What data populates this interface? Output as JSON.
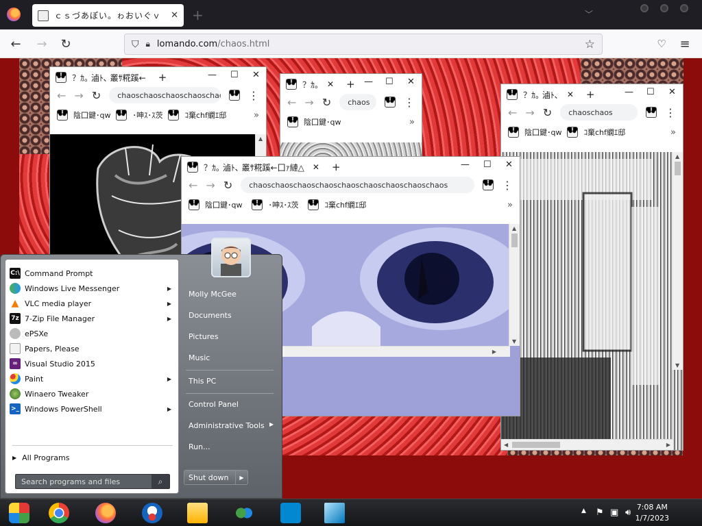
{
  "firefox": {
    "tab_title": "ｃｓづあぽい。ゎおいぐｖ",
    "url_host": "lomando.com",
    "url_path": "/chaos.html"
  },
  "windows": {
    "w1": {
      "tab": "？ｶ｡ 滷ﾄ､ 叢ｻ糀蹊←",
      "omnibox": "chaoschaoschaoschaoschao",
      "bookmarks": [
        "陰囗鍵･qw",
        "･呻ｽ･ｽ茨",
        "ｺ棄chf繝ｴ邸"
      ]
    },
    "w2": {
      "tab": "？ｶ｡",
      "omnibox": "chaos",
      "bookmarks": [
        "陰囗鍵･qw"
      ]
    },
    "w3": {
      "tab": "？ｶ｡ 滷ﾄ､",
      "omnibox": "chaoschaos",
      "bookmarks": [
        "陰囗鍵･qw",
        "ｺ棄chf繝ｴ邸"
      ]
    },
    "w4": {
      "tab": "？ｶ｡ 滷ﾄ､ 叢ｻ糀蹊←囗ｧ縺△",
      "omnibox": "chaoschaoschaoschaoschaoschaoschaoschaoschaos",
      "bookmarks": [
        "陰囗鍵･qw",
        "･呻ｽ･ｽ茨",
        "ｺ棄chf繝ｴ邸"
      ]
    }
  },
  "start_menu": {
    "programs": [
      {
        "label": "Command Prompt",
        "icon": "cmd-icon",
        "submenu": false
      },
      {
        "label": "Windows Live Messenger",
        "icon": "messenger-icon",
        "submenu": true
      },
      {
        "label": "VLC media player",
        "icon": "vlc-icon",
        "submenu": true
      },
      {
        "label": "7-Zip File Manager",
        "icon": "7zip-icon",
        "submenu": true
      },
      {
        "label": "ePSXe",
        "icon": "epsxe-icon",
        "submenu": false
      },
      {
        "label": "Papers, Please",
        "icon": "document-icon",
        "submenu": false
      },
      {
        "label": "Visual Studio 2015",
        "icon": "visual-studio-icon",
        "submenu": false
      },
      {
        "label": "Paint",
        "icon": "paint-icon",
        "submenu": true
      },
      {
        "label": "Winaero Tweaker",
        "icon": "winaero-icon",
        "submenu": false
      },
      {
        "label": "Windows PowerShell",
        "icon": "powershell-icon",
        "submenu": true
      }
    ],
    "all_programs": "All Programs",
    "search_placeholder": "Search programs and files",
    "right_items": [
      "Molly McGee",
      "Documents",
      "Pictures",
      "Music",
      "This PC",
      "Control Panel",
      "Administrative Tools",
      "Run..."
    ],
    "shutdown": "Shut down"
  },
  "taskbar": {
    "time": "7:08 AM",
    "date": "1/7/2023"
  }
}
